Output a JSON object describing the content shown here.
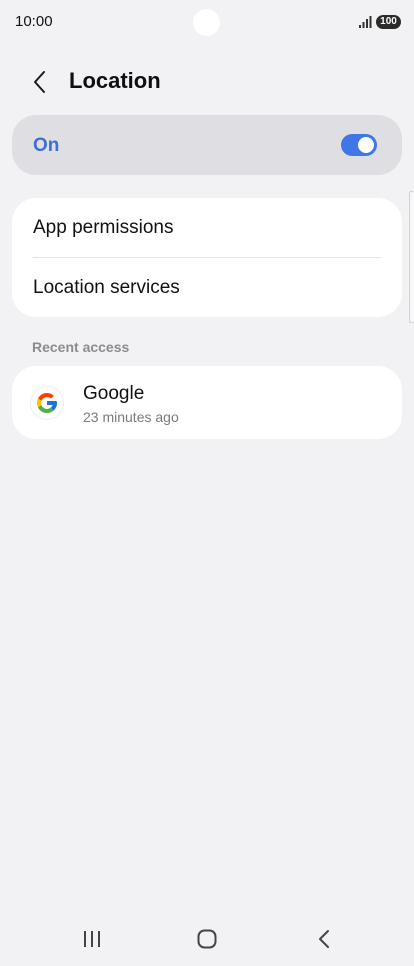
{
  "status_bar": {
    "time": "10:00",
    "battery": "100"
  },
  "header": {
    "title": "Location",
    "back_icon": "chevron-left-icon"
  },
  "master_toggle": {
    "label": "On",
    "state": true,
    "accent_color": "#3f78e6"
  },
  "settings": {
    "items": [
      {
        "label": "App permissions"
      },
      {
        "label": "Location services"
      }
    ]
  },
  "recent_access": {
    "header": "Recent access",
    "apps": [
      {
        "name": "Google",
        "subtitle": "23 minutes ago",
        "icon": "google-logo-icon"
      }
    ]
  },
  "nav_bar": {
    "recent_icon": "recent-apps-icon",
    "home_icon": "home-icon",
    "back_icon": "back-icon"
  }
}
